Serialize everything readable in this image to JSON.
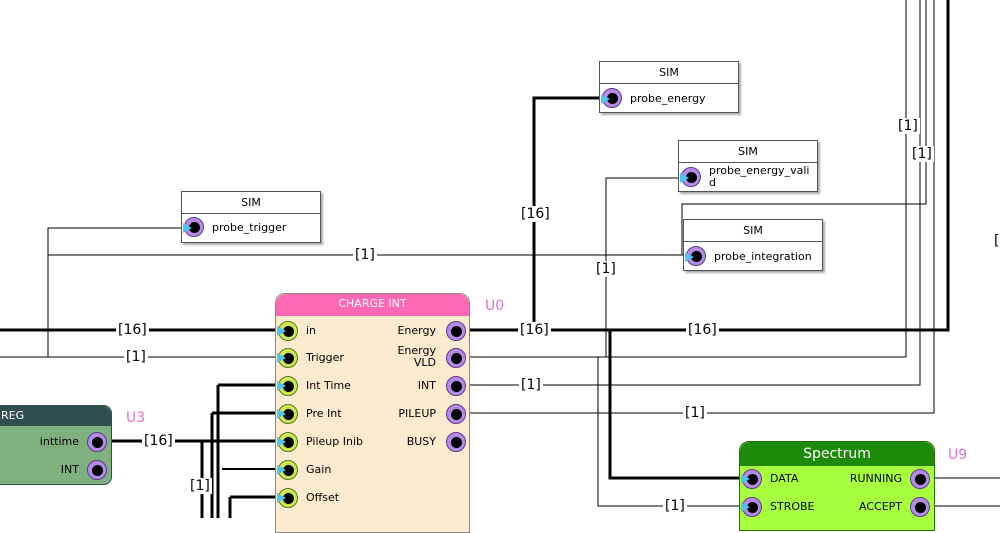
{
  "sim_blocks": [
    {
      "header": "SIM",
      "port": "probe_trigger"
    },
    {
      "header": "SIM",
      "port": "probe_energy"
    },
    {
      "header": "SIM",
      "port": "probe_energy_vali\nd"
    },
    {
      "header": "SIM",
      "port": "probe_integration"
    }
  ],
  "charge_int": {
    "title": "CHARGE INT",
    "instance": "U0",
    "inputs": [
      "in",
      "Trigger",
      "Int Time",
      "Pre Int",
      "Pileup Inib",
      "Gain",
      "Offset"
    ],
    "outputs": [
      "Energy",
      "Energy\nVLD",
      "INT",
      "PILEUP",
      "BUSY"
    ]
  },
  "reg": {
    "title": "REG",
    "instance": "U3",
    "ports": [
      "inttime",
      "INT"
    ]
  },
  "spectrum": {
    "title": "Spectrum",
    "instance": "U9",
    "inputs": [
      "DATA",
      "STROBE"
    ],
    "outputs": [
      "RUNNING",
      "ACCEPT"
    ]
  },
  "wire_labels": {
    "l1": "[1]",
    "l2": "[1]",
    "l3": "[1]",
    "l4": "[1]",
    "l5": "[16]",
    "l6": "[16]",
    "l7": "[1]",
    "l8": "[16]",
    "l9": "[16]",
    "l10": "[1]",
    "l11": "[1]",
    "l12": "[1]",
    "l13": "[16]",
    "l14": "[1]",
    "l15": "["
  },
  "colors": {
    "charge_title": "#ff69b4",
    "charge_body": "#fdebd0",
    "reg_title": "#2f4f4f",
    "reg_body": "#7fb07f",
    "spectrum_title": "#1d8a0a",
    "spectrum_body": "#a8ff3e",
    "instance_label": "#e070d0"
  }
}
